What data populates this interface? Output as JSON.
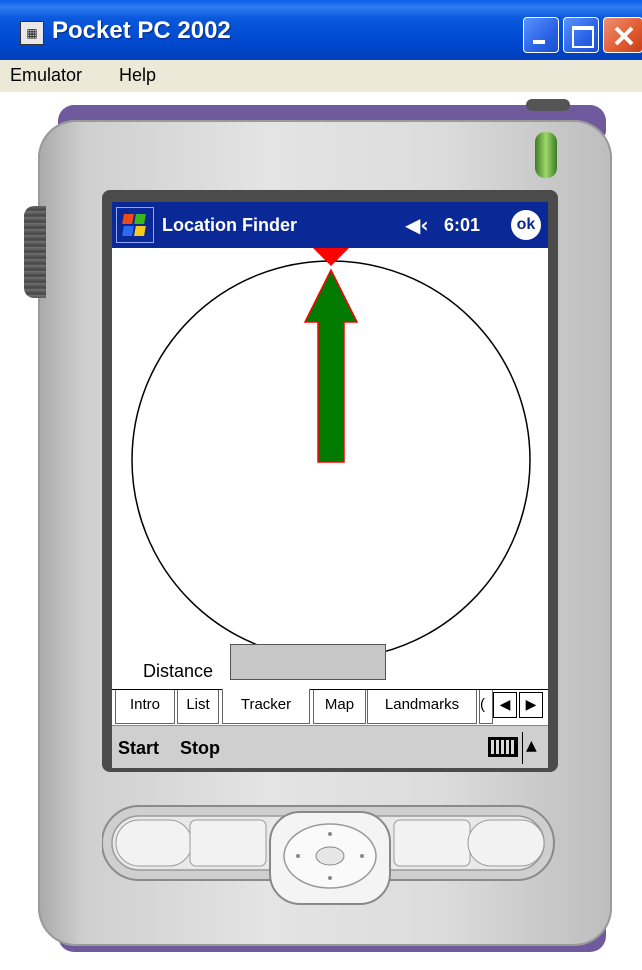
{
  "window": {
    "title": "Pocket PC 2002",
    "icon": "emulator-icon",
    "controls": [
      "minimize-icon",
      "maximize-icon",
      "close-icon"
    ]
  },
  "menubar": {
    "items": [
      "Emulator",
      "Help"
    ]
  },
  "pocketpc": {
    "app_title": "Location Finder",
    "speaker_icon": "◀‹",
    "time": "6:01",
    "ok_label": "ok",
    "distance_label": "Distance",
    "distance_value": "",
    "tabs": [
      {
        "label": "Intro",
        "selected": false
      },
      {
        "label": "List",
        "selected": false
      },
      {
        "label": "Tracker",
        "selected": true
      },
      {
        "label": "Map",
        "selected": false
      },
      {
        "label": "Landmarks",
        "selected": false
      },
      {
        "label": "(",
        "selected": false
      }
    ],
    "tab_scroll_left": "◀",
    "tab_scroll_right": "▶",
    "command_menu": [
      "Start",
      "Stop"
    ],
    "sip_arrow": "▲",
    "compass_arrow_color": "#007a00",
    "compass_marker_color": "#ff0000"
  }
}
